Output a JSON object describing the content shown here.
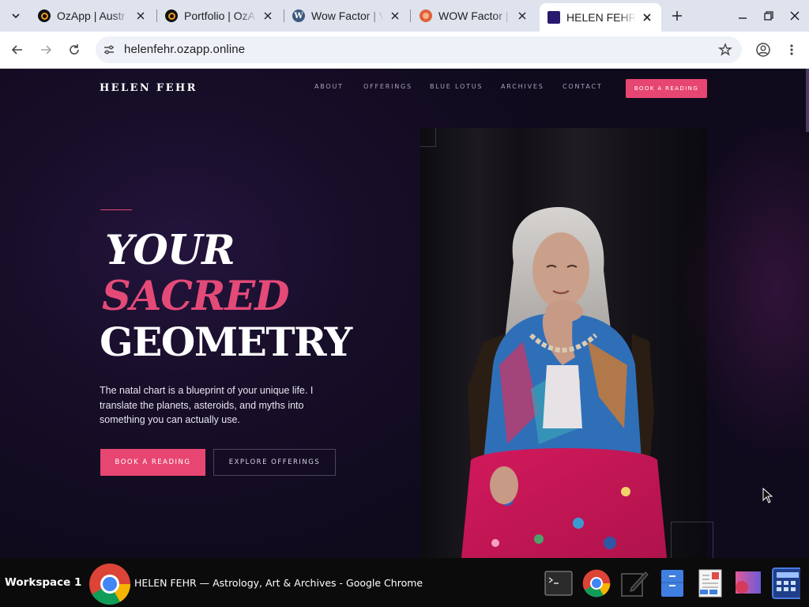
{
  "browser": {
    "tabs": [
      {
        "title": "OzApp | Austr",
        "icon": "ozapp-favicon",
        "active": false
      },
      {
        "title": "Portfolio | OzA",
        "icon": "ozapp-favicon",
        "active": false
      },
      {
        "title": "Wow Factor | V",
        "icon": "wordpress-favicon",
        "active": false
      },
      {
        "title": "WOW Factor |",
        "icon": "wowfactor-favicon",
        "active": false
      },
      {
        "title": "HELEN FEHR -",
        "icon": "helenfehr-favicon",
        "active": true
      }
    ],
    "url": "helenfehr.ozapp.online"
  },
  "site": {
    "brand": "HELEN FEHR",
    "nav": [
      "ABOUT",
      "OFFERINGS",
      "BLUE LOTUS",
      "ARCHIVES",
      "CONTACT"
    ],
    "book_top": "BOOK A READING",
    "hero": {
      "line1": "YOUR",
      "line2": "SACRED",
      "line3": "GEOMETRY",
      "lede": "The natal chart is a blueprint of your unique life. I translate the planets, asteroids, and myths into something you can actually use.",
      "primary_cta": "BOOK A READING",
      "secondary_cta": "EXPLORE OFFERINGS"
    },
    "accent": "#e74672"
  },
  "taskbar": {
    "workspace": "Workspace 1",
    "window_title": "HELEN FEHR — Astrology, Art & Archives - Google Chrome"
  }
}
